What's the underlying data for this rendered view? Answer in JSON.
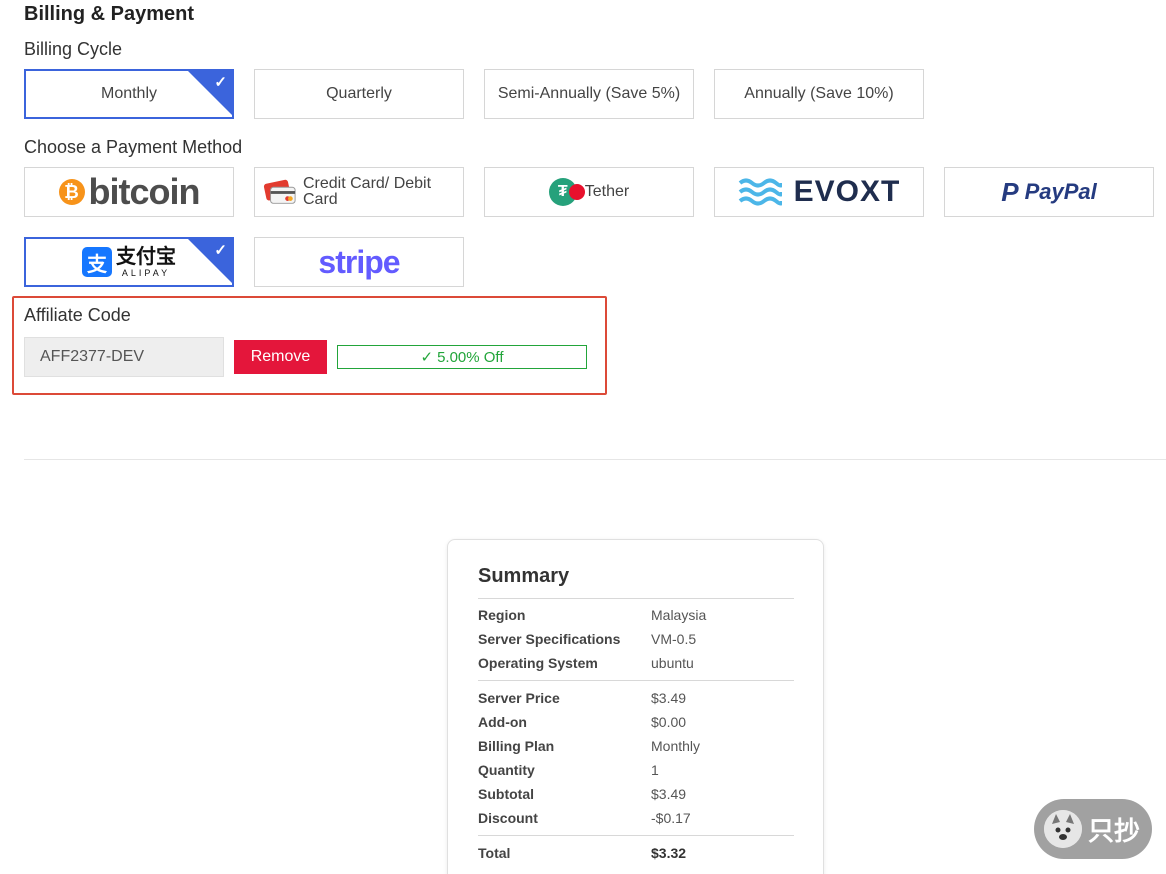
{
  "billing": {
    "title": "Billing & Payment",
    "cycle_label": "Billing Cycle",
    "cycles": [
      "Monthly",
      "Quarterly",
      "Semi-Annually (Save 5%)",
      "Annually (Save 10%)"
    ],
    "selected_cycle": "Monthly"
  },
  "payment": {
    "label": "Choose a Payment Method",
    "methods": {
      "bitcoin": "bitcoin",
      "credit_card": "Credit Card/ Debit Card",
      "tether": "Tether",
      "evoxt": "EVOXT",
      "paypal": "PayPal",
      "alipay_cn": "支付宝",
      "alipay_en": "ALIPAY",
      "stripe": "stripe"
    },
    "selected_method": "alipay"
  },
  "affiliate": {
    "label": "Affiliate Code",
    "value": "AFF2377-DEV",
    "remove_label": "Remove",
    "discount_badge": "5.00% Off"
  },
  "summary": {
    "title": "Summary",
    "rows": [
      {
        "k": "Region",
        "v": "Malaysia"
      },
      {
        "k": "Server Specifications",
        "v": "VM-0.5"
      },
      {
        "k": "Operating System",
        "v": "ubuntu"
      },
      {
        "k": "Server Price",
        "v": "$3.49"
      },
      {
        "k": "Add-on",
        "v": "$0.00"
      },
      {
        "k": "Billing Plan",
        "v": "Monthly"
      },
      {
        "k": "Quantity",
        "v": "1"
      },
      {
        "k": "Subtotal",
        "v": "$3.49"
      },
      {
        "k": "Discount",
        "v": "-$0.17"
      },
      {
        "k": "Total",
        "v": "$3.32"
      }
    ]
  },
  "watermark": {
    "text": "只抄"
  },
  "colors": {
    "accent": "#3b64dc",
    "remove": "#e4163b",
    "success": "#22a53a",
    "highlight_border": "#dc4a38"
  }
}
